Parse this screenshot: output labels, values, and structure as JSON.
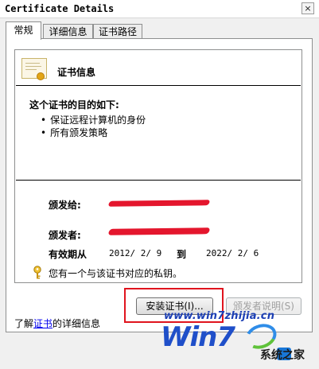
{
  "window": {
    "title": "Certificate Details",
    "close_glyph": "×"
  },
  "tabs": [
    {
      "label": "常规",
      "active": true
    },
    {
      "label": "详细信息",
      "active": false
    },
    {
      "label": "证书路径",
      "active": false
    }
  ],
  "general": {
    "header_title": "证书信息",
    "purpose_heading": "这个证书的目的如下:",
    "purposes": [
      "保证远程计算机的身份",
      "所有颁发策略"
    ],
    "issued_to_label": "颁发给:",
    "issued_by_label": "颁发者:",
    "validity_label": "有效期从",
    "valid_from": "2012/ 2/ 9",
    "to_label": "到",
    "valid_to": "2022/ 2/ 6",
    "private_key_note": "您有一个与该证书对应的私钥。"
  },
  "buttons": {
    "install": "安装证书(I)...",
    "issuer_statement": "颁发者说明(S)"
  },
  "learn_more": {
    "prefix": "了解",
    "link": "证书",
    "suffix": "的详细信息"
  },
  "watermark": {
    "url": "www.win7zhijia.cn",
    "logo": "Win7",
    "site_name": "系统之家"
  },
  "colors": {
    "highlight": "#e0141e",
    "redaction": "#e4162d",
    "link": "#0000ee"
  }
}
